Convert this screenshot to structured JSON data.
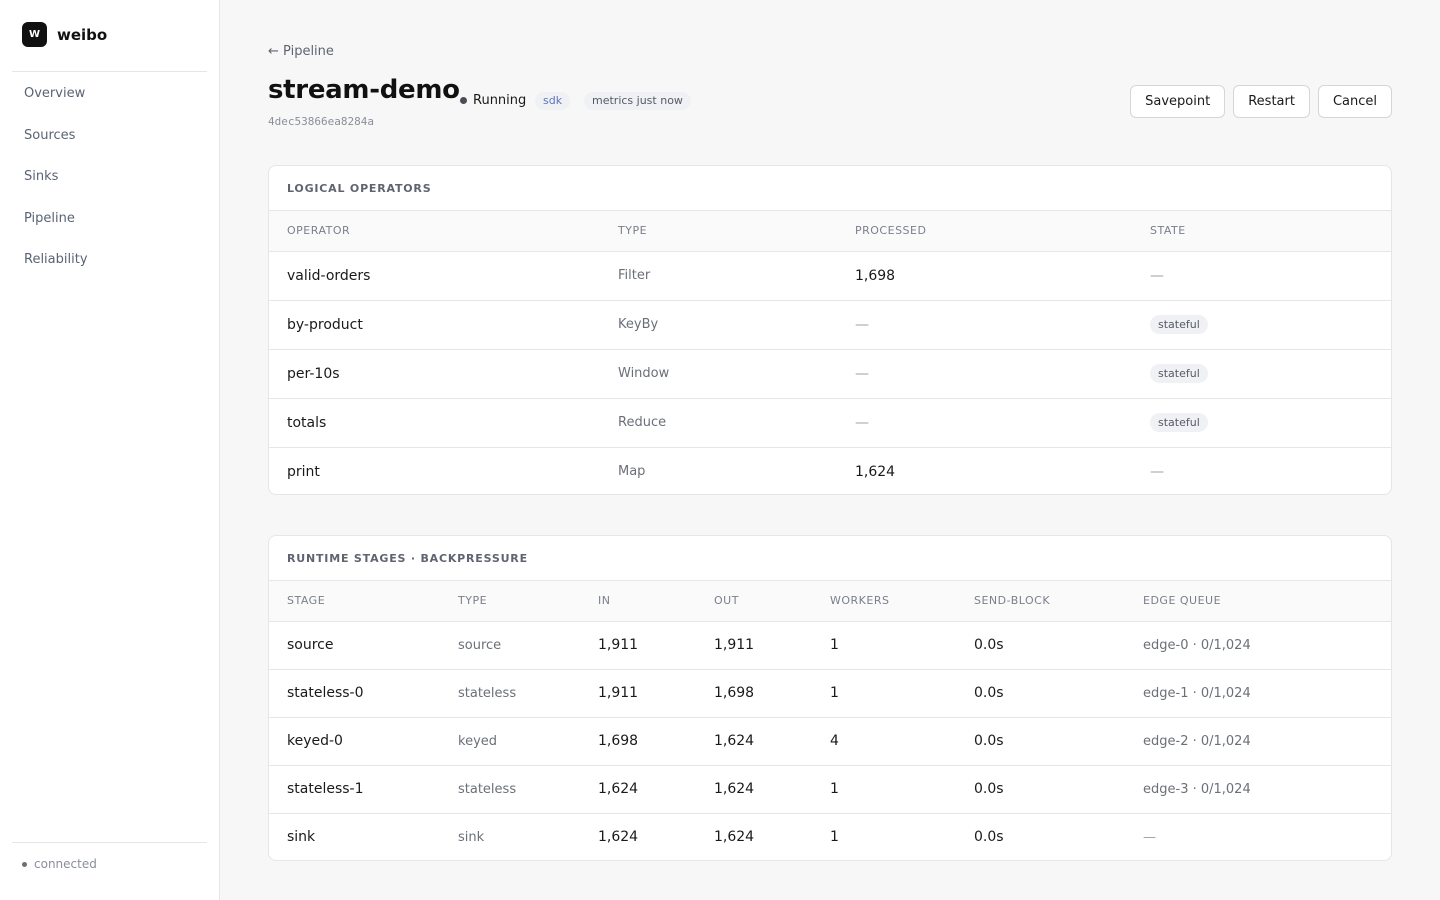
{
  "app": {
    "logo_letter": "W",
    "name": "weibo"
  },
  "nav": [
    "Overview",
    "Sources",
    "Sinks",
    "Pipeline",
    "Reliability"
  ],
  "footer": {
    "status": "connected"
  },
  "header": {
    "back": "← Pipeline",
    "title": "stream-demo",
    "status": "Running",
    "badge_sdk": "sdk",
    "badge_metrics": "metrics just now",
    "job_id": "4dec53866ea8284a",
    "buttons": {
      "savepoint": "Savepoint",
      "restart": "Restart",
      "cancel": "Cancel"
    }
  },
  "operators": {
    "title": "LOGICAL OPERATORS",
    "columns": [
      "OPERATOR",
      "TYPE",
      "PROCESSED",
      "STATE"
    ],
    "rows": [
      {
        "name": "valid-orders",
        "type": "Filter",
        "processed": "1,698",
        "state": "—"
      },
      {
        "name": "by-product",
        "type": "KeyBy",
        "processed": "—",
        "state": "stateful"
      },
      {
        "name": "per-10s",
        "type": "Window",
        "processed": "—",
        "state": "stateful"
      },
      {
        "name": "totals",
        "type": "Reduce",
        "processed": "—",
        "state": "stateful"
      },
      {
        "name": "print",
        "type": "Map",
        "processed": "1,624",
        "state": "—"
      }
    ]
  },
  "stages": {
    "title": "RUNTIME STAGES · BACKPRESSURE",
    "columns": [
      "STAGE",
      "TYPE",
      "IN",
      "OUT",
      "WORKERS",
      "SEND-BLOCK",
      "EDGE QUEUE"
    ],
    "rows": [
      {
        "stage": "source",
        "type": "source",
        "in": "1,911",
        "out": "1,911",
        "workers": "1",
        "send_block": "0.0s",
        "edge_queue": "edge-0 · 0/1,024"
      },
      {
        "stage": "stateless-0",
        "type": "stateless",
        "in": "1,911",
        "out": "1,698",
        "workers": "1",
        "send_block": "0.0s",
        "edge_queue": "edge-1 · 0/1,024"
      },
      {
        "stage": "keyed-0",
        "type": "keyed",
        "in": "1,698",
        "out": "1,624",
        "workers": "4",
        "send_block": "0.0s",
        "edge_queue": "edge-2 · 0/1,024"
      },
      {
        "stage": "stateless-1",
        "type": "stateless",
        "in": "1,624",
        "out": "1,624",
        "workers": "1",
        "send_block": "0.0s",
        "edge_queue": "edge-3 · 0/1,024"
      },
      {
        "stage": "sink",
        "type": "sink",
        "in": "1,624",
        "out": "1,624",
        "workers": "1",
        "send_block": "0.0s",
        "edge_queue": "—"
      }
    ]
  }
}
